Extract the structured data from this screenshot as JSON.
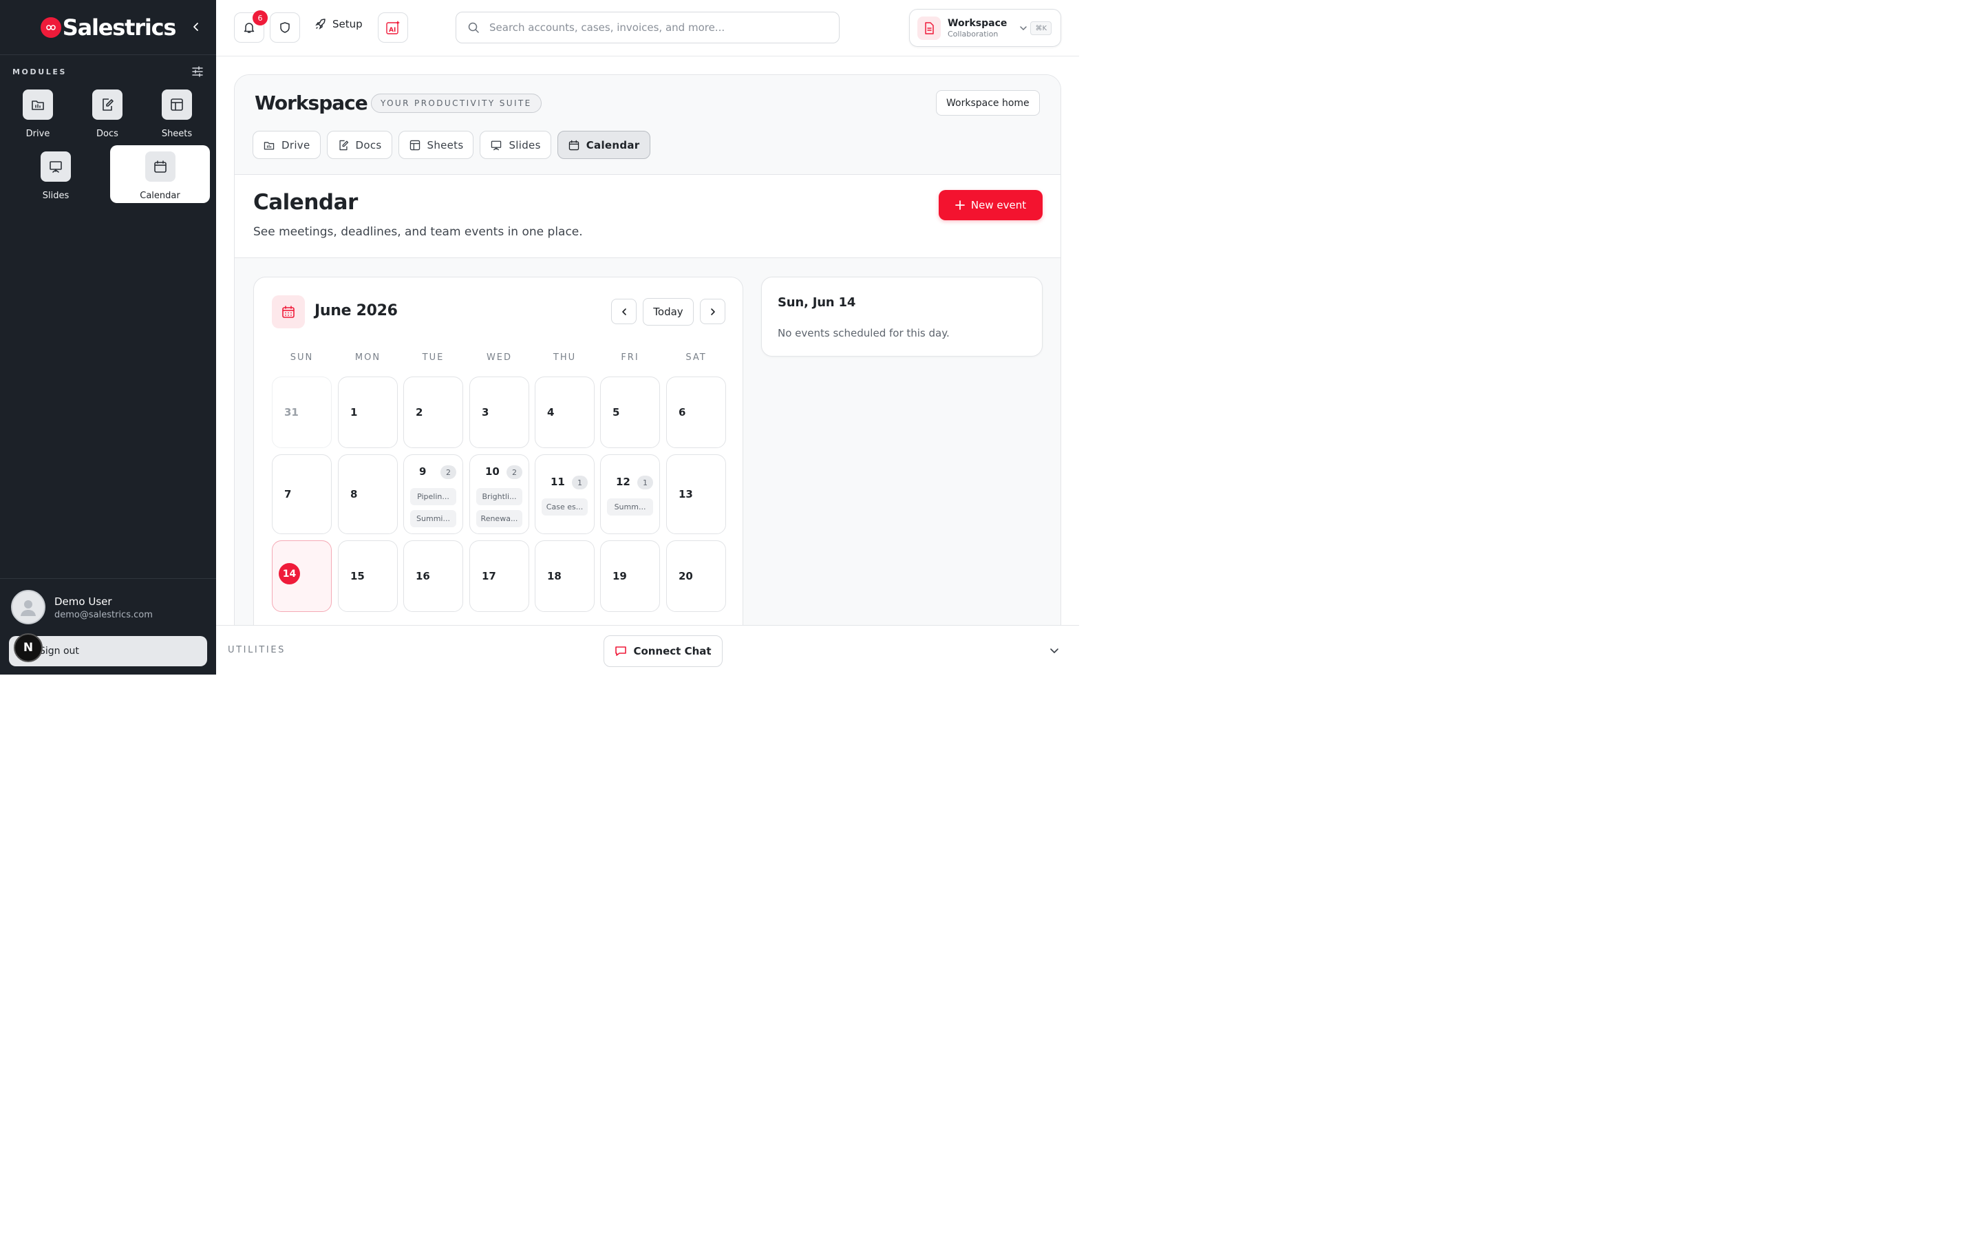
{
  "brand": {
    "name": "Salestrics"
  },
  "sidebar": {
    "modules_label": "MODULES",
    "modules": [
      {
        "label": "Drive",
        "icon": "folder-icon"
      },
      {
        "label": "Docs",
        "icon": "edit-doc-icon"
      },
      {
        "label": "Sheets",
        "icon": "table-icon"
      },
      {
        "label": "Slides",
        "icon": "presentation-icon"
      },
      {
        "label": "Calendar",
        "icon": "calendar-icon",
        "active": true
      }
    ],
    "user": {
      "name": "Demo User",
      "email": "demo@salestrics.com"
    },
    "sign_out": "Sign out",
    "n_badge": "N"
  },
  "topbar": {
    "notifications_count": "6",
    "setup_label": "Setup",
    "search_placeholder": "Search accounts, cases, invoices, and more...",
    "workspace_title": "Workspace",
    "workspace_sub": "Collaboration",
    "shortcut": "⌘K"
  },
  "workspace": {
    "logo": "Workspace",
    "tagline": "YOUR PRODUCTIVITY SUITE",
    "home_button": "Workspace home",
    "tabs": [
      "Drive",
      "Docs",
      "Sheets",
      "Slides",
      "Calendar"
    ]
  },
  "calendar": {
    "title": "Calendar",
    "description": "See meetings, deadlines, and team events in one place.",
    "new_event": "New event",
    "month": "June 2026",
    "today_button": "Today",
    "weekdays": [
      "SUN",
      "MON",
      "TUE",
      "WED",
      "THU",
      "FRI",
      "SAT"
    ],
    "weeks": [
      [
        {
          "d": "31",
          "muted": true
        },
        {
          "d": "1"
        },
        {
          "d": "2"
        },
        {
          "d": "3"
        },
        {
          "d": "4"
        },
        {
          "d": "5"
        },
        {
          "d": "6"
        }
      ],
      [
        {
          "d": "7"
        },
        {
          "d": "8"
        },
        {
          "d": "9",
          "count": "2",
          "events": [
            "Pipelin...",
            "Summi..."
          ]
        },
        {
          "d": "10",
          "count": "2",
          "events": [
            "Brightli...",
            "Renewa..."
          ]
        },
        {
          "d": "11",
          "count": "1",
          "events": [
            "Case es..."
          ]
        },
        {
          "d": "12",
          "count": "1",
          "events": [
            "Summ..."
          ]
        },
        {
          "d": "13"
        }
      ],
      [
        {
          "d": "14",
          "today": true
        },
        {
          "d": "15"
        },
        {
          "d": "16"
        },
        {
          "d": "17"
        },
        {
          "d": "18"
        },
        {
          "d": "19"
        },
        {
          "d": "20"
        }
      ]
    ],
    "selected_date": "Sun, Jun 14",
    "no_events": "No events scheduled for this day."
  },
  "utilities": {
    "label": "UTILITIES",
    "connect_chat": "Connect Chat"
  },
  "colors": {
    "accent": "#ef1b3a",
    "sidebar_bg": "#1c2128"
  }
}
